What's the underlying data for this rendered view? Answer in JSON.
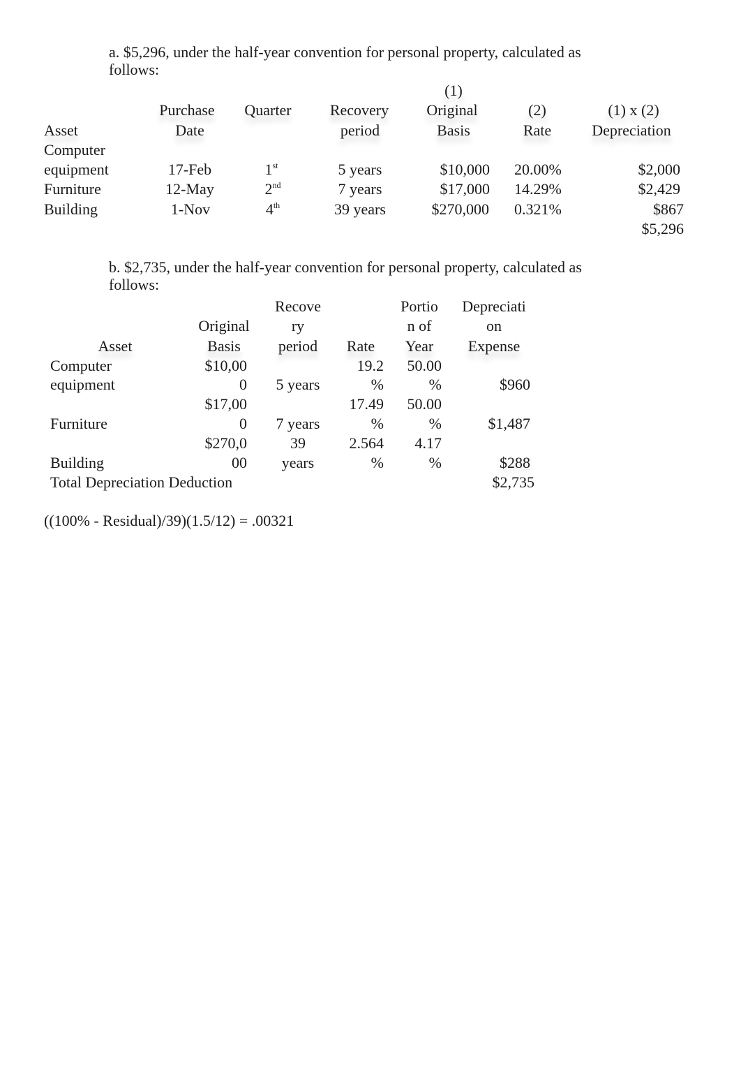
{
  "part_a": {
    "intro_line1": "a. $5,296, under the half-year convention for personal property, calculated as",
    "intro_line2": "follows:",
    "headers": {
      "asset": "Asset",
      "purchase_line1": "Purchase",
      "purchase_line2": "Date",
      "quarter": "Quarter",
      "recovery_line1": "Recovery",
      "recovery_line2": "period",
      "basis_line0": "(1)",
      "basis_line1": "Original",
      "basis_line2": "Basis",
      "rate_line1": "(2)",
      "rate_line2": "Rate",
      "dep_line1": "(1) x (2)",
      "dep_line2": "Depreciation"
    },
    "rows": [
      {
        "asset_line1": "Computer",
        "asset_line2": "equipment",
        "date": "17-Feb",
        "quarter_num": "1",
        "quarter_suffix": "st",
        "recovery": "5 years",
        "basis": "$10,000",
        "rate": "20.00%",
        "depreciation": "$2,000"
      },
      {
        "asset": "Furniture",
        "date": "12-May",
        "quarter_num": "2",
        "quarter_suffix": "nd",
        "recovery": "7 years",
        "basis": "$17,000",
        "rate": "14.29%",
        "depreciation": "$2,429"
      },
      {
        "asset": "Building",
        "date": "1-Nov",
        "quarter_num": "4",
        "quarter_suffix": "th",
        "recovery": "39 years",
        "basis": "$270,000",
        "rate": "0.321%",
        "depreciation": "$867"
      }
    ],
    "total": "$5,296"
  },
  "part_b": {
    "intro_line1": "b. $2,735, under the half-year convention for personal property, calculated as",
    "intro_line2": "follows:",
    "headers": {
      "asset": "Asset",
      "basis_line1": "Original",
      "basis_line2": "Basis",
      "recovery_line1": "Recove",
      "recovery_line2": "ry",
      "recovery_line3": "period",
      "rate": "Rate",
      "portion_line1": "Portio",
      "portion_line2": "n of",
      "portion_line3": "Year",
      "dep_line1": "Depreciati",
      "dep_line2": "on",
      "dep_line3": "Expense"
    },
    "rows": [
      {
        "asset_line1": "Computer",
        "asset_line2": "equipment",
        "basis_line1": "$10,00",
        "basis_line2": "0",
        "recovery_line1": "",
        "recovery_line2": "5 years",
        "rate_line1": "19.2",
        "rate_line2": "%",
        "portion_line1": "50.00",
        "portion_line2": "%",
        "expense": "$960"
      },
      {
        "asset_line1": "",
        "asset_line2": "Furniture",
        "basis_line1": "$17,00",
        "basis_line2": "0",
        "recovery_line1": "",
        "recovery_line2": "7 years",
        "rate_line1": "17.49",
        "rate_line2": "%",
        "portion_line1": "50.00",
        "portion_line2": "%",
        "expense": "$1,487"
      },
      {
        "asset_line1": "",
        "asset_line2": "Building",
        "basis_line1": "$270,0",
        "basis_line2": "00",
        "recovery_line1": "39",
        "recovery_line2": "years",
        "rate_line1": "2.564",
        "rate_line2": "%",
        "portion_line1": "4.17",
        "portion_line2": "%",
        "expense": "$288"
      }
    ],
    "total_label": "Total Depreciation Deduction",
    "total": "$2,735"
  },
  "footnote": "((100% - Residual)/39)(1.5/12) = .00321"
}
